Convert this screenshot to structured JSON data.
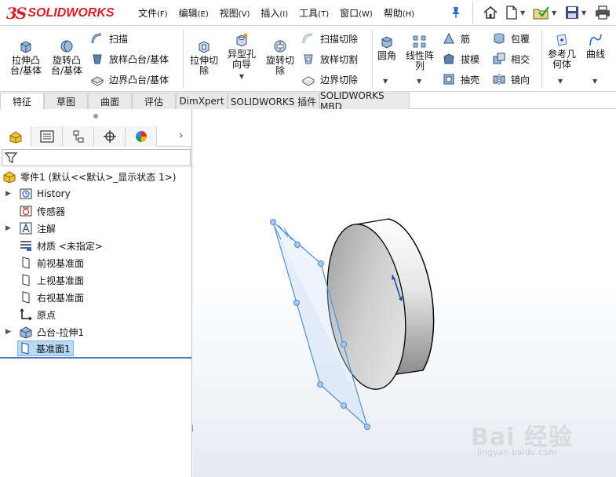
{
  "app": {
    "logo_ds": "3S",
    "logo_text": "SOLIDWORKS"
  },
  "menu": [
    {
      "label": "文件",
      "shortcut": "(F)"
    },
    {
      "label": "编辑",
      "shortcut": "(E)"
    },
    {
      "label": "视图",
      "shortcut": "(V)"
    },
    {
      "label": "插入",
      "shortcut": "(I)"
    },
    {
      "label": "工具",
      "shortcut": "(T)"
    },
    {
      "label": "窗口",
      "shortcut": "(W)"
    },
    {
      "label": "帮助",
      "shortcut": "(H)"
    }
  ],
  "quick_access": [
    "home-icon",
    "new-document-icon",
    "open-icon",
    "save-icon",
    "print-icon"
  ],
  "ribbon": {
    "extrude_boss": "拉伸凸\n台/基体",
    "revolve_boss": "旋转凸\n台/基体",
    "sweep": "扫描",
    "loft_boss": "放样凸台/基体",
    "boundary_boss": "边界凸台/基体",
    "extrude_cut": "拉伸切\n除",
    "hole_wizard": "异型孔\n向导",
    "revolve_cut": "旋转切\n除",
    "swept_cut": "扫描切除",
    "lofted_cut": "放样切割",
    "boundary_cut": "边界切除",
    "fillet": "圆角",
    "linear_pattern": "线性阵\n列",
    "rib": "筋",
    "draft": "拔模",
    "shell": "抽壳",
    "wrap": "包覆",
    "intersect": "相交",
    "mirror": "镜向",
    "ref_geometry": "参考几\n何体",
    "curves": "曲线"
  },
  "tabs": [
    "特征",
    "草图",
    "曲面",
    "评估",
    "DimXpert",
    "SOLIDWORKS 插件",
    "SOLIDWORKS MBD"
  ],
  "panel_tabs": [
    "feature-manager-icon",
    "property-manager-icon",
    "configuration-manager-icon",
    "dimxpert-manager-icon",
    "display-manager-icon"
  ],
  "tree": {
    "root": "零件1 (默认<<默认>_显示状态 1>)",
    "items": [
      {
        "label": "History",
        "icon": "history-icon",
        "expandable": true
      },
      {
        "label": "传感器",
        "icon": "sensor-icon",
        "expandable": false
      },
      {
        "label": "注解",
        "icon": "annotation-icon",
        "expandable": true
      },
      {
        "label": "材质 <未指定>",
        "icon": "material-icon",
        "expandable": false
      },
      {
        "label": "前视基准面",
        "icon": "plane-icon",
        "expandable": false
      },
      {
        "label": "上视基准面",
        "icon": "plane-icon",
        "expandable": false
      },
      {
        "label": "右视基准面",
        "icon": "plane-icon",
        "expandable": false
      },
      {
        "label": "原点",
        "icon": "origin-icon",
        "expandable": false
      },
      {
        "label": "凸台-拉伸1",
        "icon": "boss-extrude-icon",
        "expandable": true
      },
      {
        "label": "基准面1",
        "icon": "plane-icon",
        "expandable": false,
        "selected": true
      }
    ]
  },
  "watermark": {
    "main": "Bai 经验",
    "sub": "jingyan.baidu.com"
  },
  "colors": {
    "brand": "#d32027",
    "selection": "#b9d9f5",
    "plane_edge": "#4a90d9",
    "accent_blue": "#1f4fa8"
  }
}
